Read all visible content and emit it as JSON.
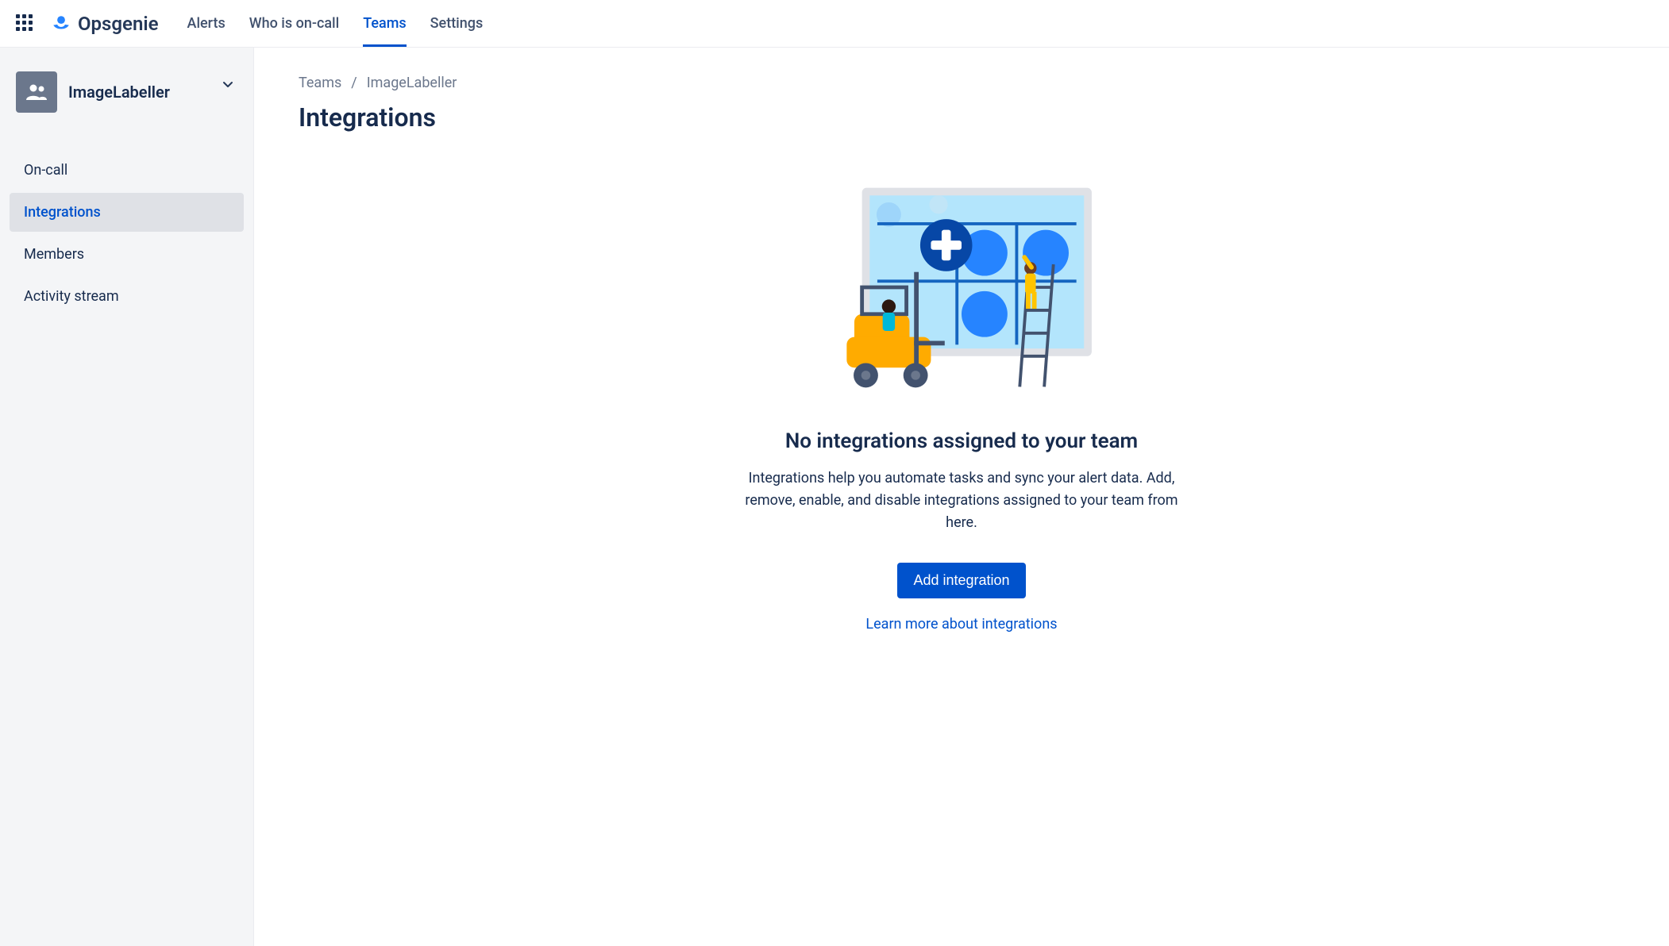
{
  "header": {
    "product_name": "Opsgenie",
    "nav": [
      {
        "label": "Alerts",
        "active": false
      },
      {
        "label": "Who is on-call",
        "active": false
      },
      {
        "label": "Teams",
        "active": true
      },
      {
        "label": "Settings",
        "active": false
      }
    ]
  },
  "sidebar": {
    "team_name": "ImageLabeller",
    "items": [
      {
        "label": "On-call",
        "active": false
      },
      {
        "label": "Integrations",
        "active": true
      },
      {
        "label": "Members",
        "active": false
      },
      {
        "label": "Activity stream",
        "active": false
      }
    ]
  },
  "breadcrumb": {
    "root": "Teams",
    "current": "ImageLabeller",
    "separator": "/"
  },
  "main": {
    "title": "Integrations",
    "empty_title": "No integrations assigned to your team",
    "empty_desc": "Integrations help you automate tasks and sync your alert data. Add, remove, enable, and disable integrations assigned to your team from here.",
    "add_button": "Add integration",
    "learn_more": "Learn more about integrations"
  }
}
